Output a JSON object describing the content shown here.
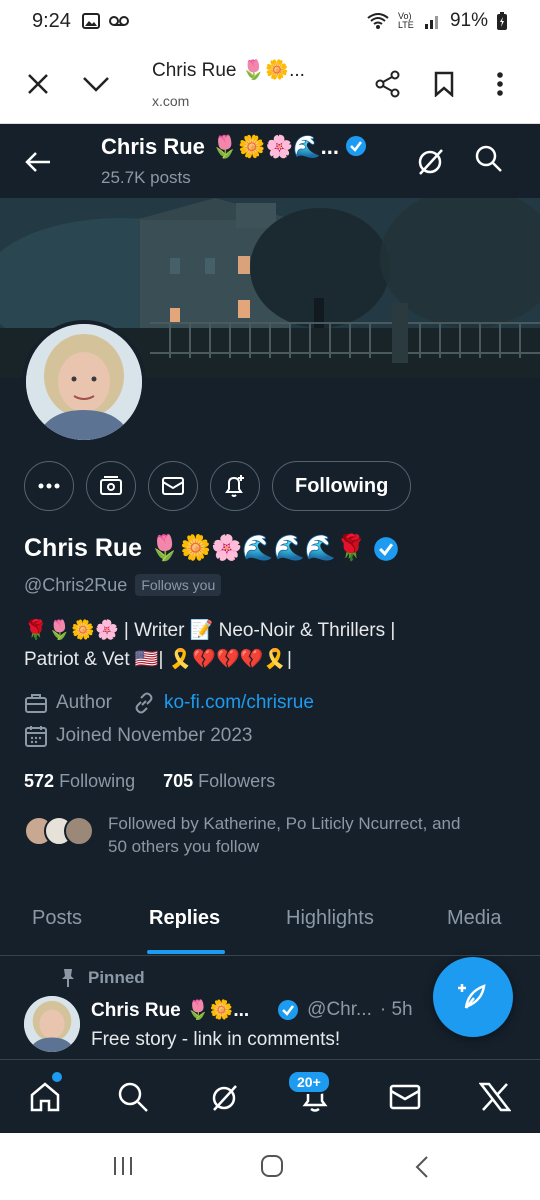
{
  "status_bar": {
    "time": "9:24",
    "battery": "91%",
    "network_label": "Vo) LTE"
  },
  "browser": {
    "page_title": "Chris Rue 🌷🌼...",
    "url": "x.com"
  },
  "profile_header": {
    "name": "Chris Rue 🌷🌼🌸🌊...",
    "posts": "25.7K posts"
  },
  "profile": {
    "display_name": "Chris Rue 🌷🌼🌸🌊🌊🌊🌹",
    "handle": "@Chris2Rue",
    "follows_you": "Follows you",
    "bio_line1": "🌹🌷🌼🌸 | Writer 📝 Neo-Noir & Thrillers |",
    "bio_line2": "Patriot & Vet 🇺🇸| 🎗️💔💔💔🎗️|",
    "occupation": "Author",
    "website": "ko-fi.com/chrisrue",
    "joined": "Joined November 2023",
    "following_count": "572",
    "following_label": "Following",
    "followers_count": "705",
    "followers_label": "Followers",
    "followed_by_line1": "Followed by Katherine, Po Liticly Ncurrect, and",
    "followed_by_line2": "50 others you follow"
  },
  "actions": {
    "following_button": "Following"
  },
  "tabs": [
    "Posts",
    "Replies",
    "Highlights",
    "Media"
  ],
  "pinned_tweet": {
    "pinned_label": "Pinned",
    "name": "Chris Rue 🌷🌼...",
    "handle": "@Chr...",
    "time": "· 5h",
    "text": "Free story - link in comments!"
  },
  "bottom_nav": {
    "notifications_badge": "20+"
  },
  "colors": {
    "background": "#15202b",
    "accent": "#1d9bf0",
    "muted_text": "#8b98a5",
    "border": "#536471"
  }
}
